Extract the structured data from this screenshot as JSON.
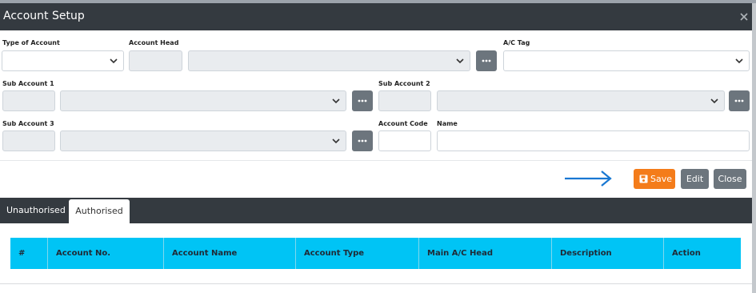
{
  "modal": {
    "title": "Account Setup"
  },
  "form": {
    "type_of_account_label": "Type of Account",
    "account_head_label": "Account Head",
    "ac_tag_label": "A/C Tag",
    "sub_account_1_label": "Sub Account 1",
    "sub_account_2_label": "Sub Account 2",
    "sub_account_3_label": "Sub Account 3",
    "account_code_label": "Account Code",
    "name_label": "Name"
  },
  "actions": {
    "save_label": "Save",
    "edit_label": "Edit",
    "close_label": "Close"
  },
  "tabs": [
    {
      "label": "Unauthorised",
      "active": false
    },
    {
      "label": "Authorised",
      "active": true
    }
  ],
  "table": {
    "headers": [
      "#",
      "Account No.",
      "Account Name",
      "Account Type",
      "Main A/C Head",
      "Description",
      "Action"
    ]
  },
  "colors": {
    "header_bg": "#343a40",
    "save": "#f47c1a",
    "secondary": "#6c757d",
    "table_header": "#00c4f5",
    "arrow": "#1877d2"
  },
  "icons": {
    "save": "floppy-disk-icon",
    "more": "ellipsis-icon",
    "close": "close-icon",
    "dropdown": "chevron-down-icon"
  }
}
